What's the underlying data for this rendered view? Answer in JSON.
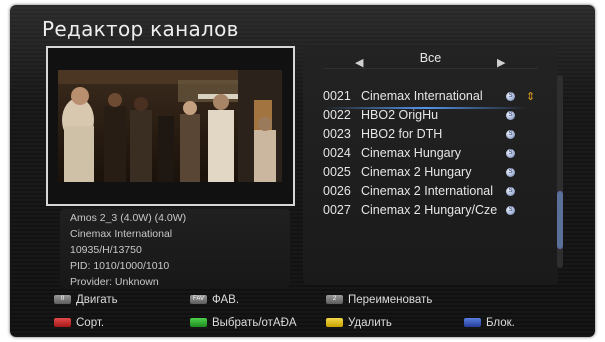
{
  "title": "Редактор каналов",
  "info": {
    "satellite": "Amos 2_3 (4.0W) (4.0W)",
    "channel": "Cinemax International",
    "transponder": "10935/H/13750",
    "pid": "PID: 1010/1000/1010",
    "provider": "Provider: Unknown"
  },
  "list": {
    "group": "Все",
    "prev_icon": "left-triangle-icon",
    "next_icon": "right-triangle-icon",
    "selected_index": 0,
    "channels": [
      {
        "num": "0021",
        "name": "Cinemax International"
      },
      {
        "num": "0022",
        "name": "HBO2 OrigHu"
      },
      {
        "num": "0023",
        "name": "HBO2 for DTH"
      },
      {
        "num": "0024",
        "name": "Cinemax Hungary"
      },
      {
        "num": "0025",
        "name": "Cinemax 2 Hungary"
      },
      {
        "num": "0026",
        "name": "Cinemax 2 International"
      },
      {
        "num": "0027",
        "name": "Cinemax 2 Hungary/Cze"
      }
    ],
    "scramble_icon": "scrambled-s-icon",
    "move_icon": "move-arrows-icon"
  },
  "legend": {
    "move": {
      "key": "0",
      "label": "Двигать"
    },
    "fav": {
      "key": "FAV",
      "label": "ФАВ."
    },
    "rename": {
      "key": "2",
      "label": "Переименовать"
    },
    "sort": {
      "label": "Сорт."
    },
    "select": {
      "label": "Выбрать/отАÐA"
    },
    "delete": {
      "label": "Удалить"
    },
    "lock": {
      "label": "Блок."
    }
  },
  "colors": {
    "red": "#c22a2a",
    "green": "#2aa52a",
    "yellow": "#e0bb10",
    "blue": "#3a5bc0",
    "selection": "#5aa0ff"
  }
}
